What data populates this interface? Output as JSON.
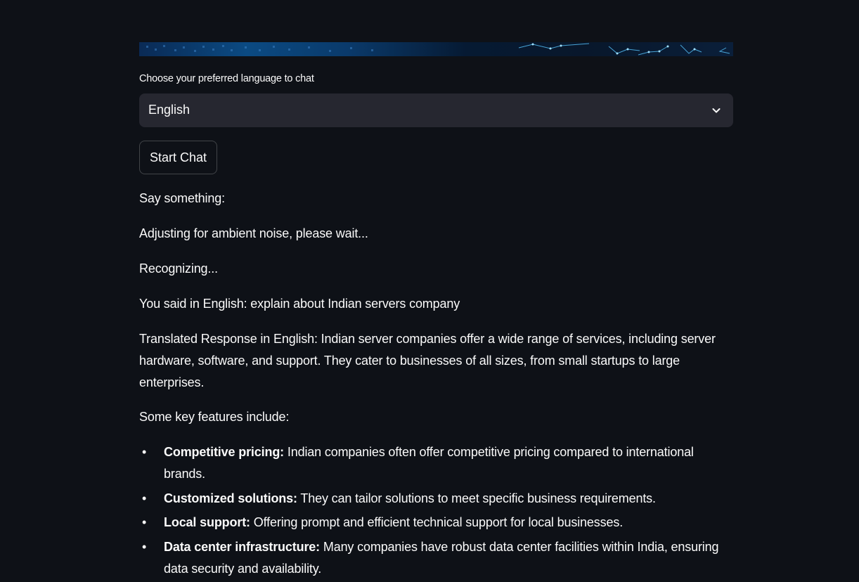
{
  "language_select": {
    "label": "Choose your preferred language to chat",
    "value": "English"
  },
  "start_button": {
    "label": "Start Chat"
  },
  "messages": {
    "say_something": "Say something:",
    "adjusting": "Adjusting for ambient noise, please wait...",
    "recognizing": "Recognizing...",
    "you_said": "You said in English: explain about Indian servers company",
    "translated": "Translated Response in English: Indian server companies offer a wide range of services, including server hardware, software, and support. They cater to businesses of all sizes, from small startups to large enterprises.",
    "key_features_intro": "Some key features include:"
  },
  "features": [
    {
      "title": "Competitive pricing:",
      "text": " Indian companies often offer competitive pricing compared to international brands."
    },
    {
      "title": "Customized solutions:",
      "text": " They can tailor solutions to meet specific business requirements."
    },
    {
      "title": "Local support:",
      "text": " Offering prompt and efficient technical support for local businesses."
    },
    {
      "title": "Data center infrastructure:",
      "text": " Many companies have robust data center facilities within India, ensuring data security and availability."
    }
  ],
  "icons": {
    "dropdown": "chevron-down-icon",
    "bullet": "•"
  },
  "colors": {
    "background": "#0e1117",
    "select_background": "#262730",
    "text": "#fafafa"
  }
}
